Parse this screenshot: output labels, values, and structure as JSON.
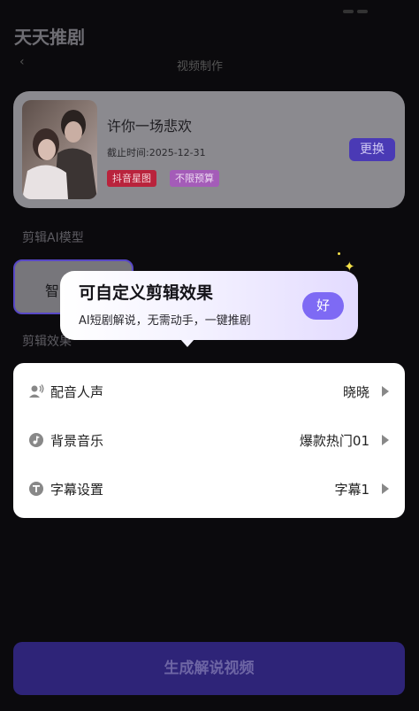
{
  "app": {
    "title": "天天推剧"
  },
  "sub_nav": {
    "title": "视频制作"
  },
  "drama": {
    "title": "许你一场悲欢",
    "deadline": "截止时间:2025-12-31",
    "tags": [
      "抖音星图",
      "不限预算"
    ],
    "change_label": "更换"
  },
  "model_section": {
    "label": "剪辑AI模型",
    "selected": "智"
  },
  "effect_section": {
    "label": "剪辑效果"
  },
  "popup": {
    "title": "可自定义剪辑效果",
    "desc": "AI短剧解说，无需动手，一键推剧",
    "ok_label": "好"
  },
  "settings": [
    {
      "label": "配音人声",
      "value": "晓晓",
      "icon": "voice-icon"
    },
    {
      "label": "背景音乐",
      "value": "爆款热门01",
      "icon": "music-icon"
    },
    {
      "label": "字幕设置",
      "value": "字幕1",
      "icon": "subtitle-icon"
    }
  ],
  "generate": {
    "label": "生成解说视频"
  },
  "colors": {
    "accent": "#7e6af4",
    "button_dim": "#2e2478",
    "tag_red": "#b9233c",
    "tag_purple": "#a45cb8"
  }
}
